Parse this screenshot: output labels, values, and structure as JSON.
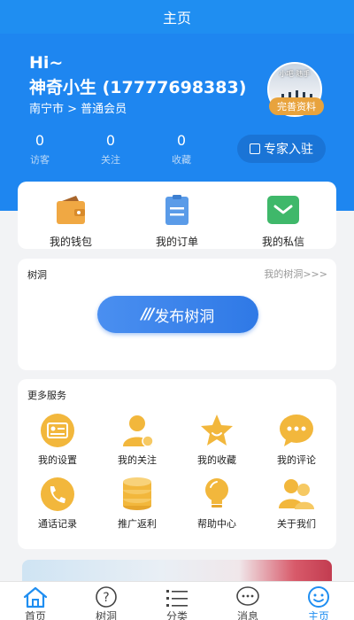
{
  "title": "主页",
  "profile": {
    "greeting": "Hi~",
    "name": "神奇小生 (17777698383)",
    "region": "南宁市 > 普通会员",
    "avatar_text": "小吧·随手",
    "complete_label": "完善资料"
  },
  "stats": [
    {
      "value": "0",
      "label": "访客"
    },
    {
      "value": "0",
      "label": "关注"
    },
    {
      "value": "0",
      "label": "收藏"
    }
  ],
  "expert_label": "专家入驻",
  "quick": [
    {
      "label": "我的钱包",
      "icon": "wallet-icon"
    },
    {
      "label": "我的订单",
      "icon": "clipboard-icon"
    },
    {
      "label": "我的私信",
      "icon": "message-icon"
    }
  ],
  "shudong": {
    "title": "树洞",
    "link": "我的树洞>>>",
    "publish_slashes": "///",
    "publish_label": "发布树洞"
  },
  "more": {
    "title": "更多服务",
    "items": [
      {
        "label": "我的设置",
        "icon": "id-card-icon"
      },
      {
        "label": "我的关注",
        "icon": "user-icon"
      },
      {
        "label": "我的收藏",
        "icon": "star-icon"
      },
      {
        "label": "我的评论",
        "icon": "comment-icon"
      },
      {
        "label": "通话记录",
        "icon": "phone-icon"
      },
      {
        "label": "推广返利",
        "icon": "coins-icon"
      },
      {
        "label": "帮助中心",
        "icon": "lightbulb-icon"
      },
      {
        "label": "关于我们",
        "icon": "users-icon"
      }
    ]
  },
  "tabs": [
    {
      "label": "首页",
      "icon": "home-icon"
    },
    {
      "label": "树洞",
      "icon": "question-icon"
    },
    {
      "label": "分类",
      "icon": "list-icon"
    },
    {
      "label": "消息",
      "icon": "chat-icon"
    },
    {
      "label": "主页",
      "icon": "smile-icon",
      "active": true
    }
  ],
  "colors": {
    "primary": "#1f8ef1",
    "gold": "#f2b73c",
    "orange": "#e8a33d"
  }
}
